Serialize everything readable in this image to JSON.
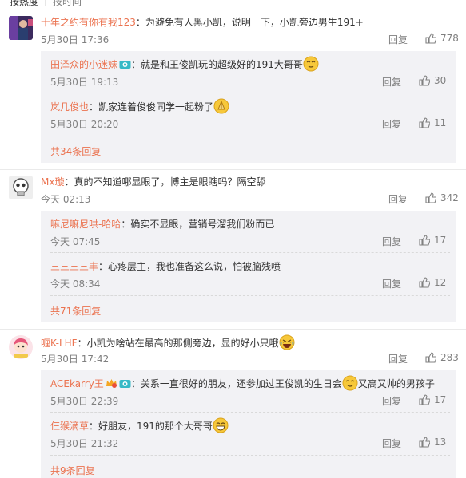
{
  "sort": {
    "hot": "按热度",
    "time": "按时间"
  },
  "reply_label": "回复",
  "comments": [
    {
      "user": "十年之约有你有我123",
      "text": "：为避免有人黑小凯，说明一下，小凯旁边男生191+",
      "time": "5月30日 17:36",
      "likes": "778",
      "replies": [
        {
          "user": "田泽众的小迷妹",
          "text": "：就是和王俊凯玩的超级好的191大哥哥",
          "time": "5月30日 19:13",
          "likes": "30"
        },
        {
          "user": "岚几俊也",
          "text": "：凯家连着俊俊同学一起粉了",
          "time": "5月30日 20:20",
          "likes": "11"
        }
      ],
      "more": "共34条回复"
    },
    {
      "user": "Mx璇",
      "text": "：真的不知道哪显眼了，博主是眼瞎吗？隔空舔",
      "time": "今天 02:13",
      "likes": "342",
      "replies": [
        {
          "user": "嘛尼嘛尼哄-哈哈",
          "text": "：确实不显眼，营销号溜我们粉而已",
          "time": "今天 07:45",
          "likes": "17"
        },
        {
          "user": "三三三三丰",
          "text": "：心疼层主，我也准备这么说，怕被脑残喷",
          "time": "今天 08:34",
          "likes": "12"
        }
      ],
      "more": "共71条回复"
    },
    {
      "user": "喱K-LHF",
      "text": "：小凯为啥站在最高的那侧旁边，显的好小只哦",
      "time": "5月30日 17:42",
      "likes": "283",
      "replies": [
        {
          "user": "ACEkarry王",
          "text": "：关系一直很好的朋友，还参加过王俊凯的生日会",
          "text2": "又高又帅的男孩子",
          "time": "5月30日 22:39",
          "likes": "17"
        },
        {
          "user": "仨猴滴草",
          "text": "：好朋友，191的那个大哥哥",
          "time": "5月30日 21:32",
          "likes": "13"
        }
      ],
      "more": "共9条回复"
    }
  ],
  "colors": {
    "username": "#eb7350",
    "meta": "#808080",
    "reply_bg": "#f2f2f5"
  }
}
